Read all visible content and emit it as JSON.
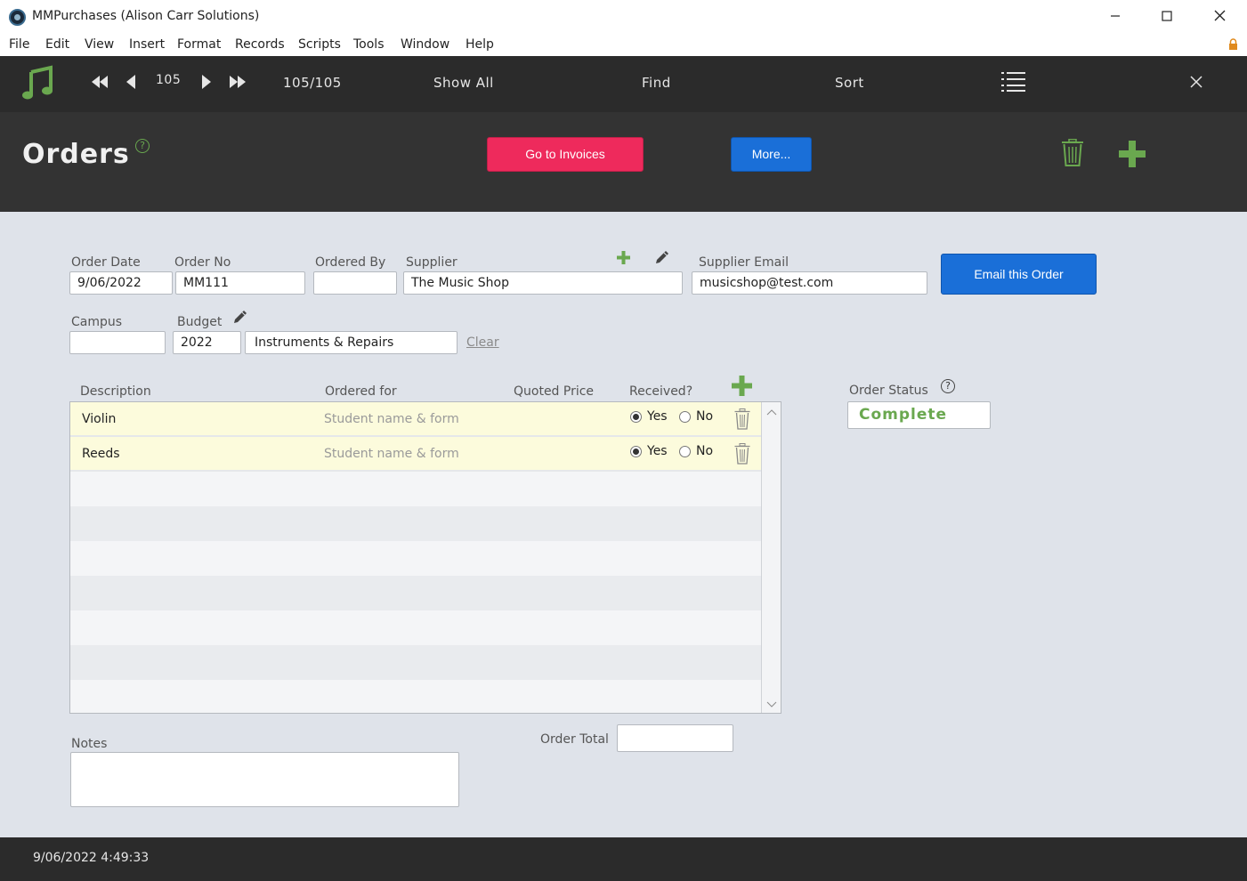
{
  "window": {
    "title": "MMPurchases (Alison Carr Solutions)",
    "minimize": "—",
    "maximize": "☐",
    "close": "✕"
  },
  "menu": [
    "File",
    "Edit",
    "View",
    "Insert",
    "Format",
    "Records",
    "Scripts",
    "Tools",
    "Window",
    "Help"
  ],
  "toolbar": {
    "record_number": "105",
    "record_count": "105/105",
    "show_all": "Show All",
    "find": "Find",
    "sort": "Sort"
  },
  "header": {
    "title": "Orders",
    "help": "?",
    "go_to_invoices": "Go to Invoices",
    "more": "More..."
  },
  "form": {
    "order_date": {
      "label": "Order Date",
      "value": "9/06/2022"
    },
    "order_no": {
      "label": "Order No",
      "value": "MM111"
    },
    "ordered_by": {
      "label": "Ordered By",
      "value": ""
    },
    "supplier": {
      "label": "Supplier",
      "value": "The Music Shop"
    },
    "supplier_email": {
      "label": "Supplier Email",
      "value": "musicshop@test.com"
    },
    "email_button": "Email this Order",
    "campus": {
      "label": "Campus",
      "value": ""
    },
    "budget": {
      "label": "Budget",
      "year": "2022",
      "name": "Instruments & Repairs"
    },
    "clear": "Clear"
  },
  "portal": {
    "headers": {
      "description": "Description",
      "ordered_for": "Ordered for",
      "quoted_price": "Quoted Price",
      "received": "Received?"
    },
    "rows": [
      {
        "description": "Violin",
        "ordered_for_placeholder": "Student name & form",
        "received": "Yes"
      },
      {
        "description": "Reeds",
        "ordered_for_placeholder": "Student name & form",
        "received": "Yes"
      }
    ],
    "yes_label": "Yes",
    "no_label": "No"
  },
  "status": {
    "label": "Order Status",
    "help": "?",
    "value": "Complete"
  },
  "notes": {
    "label": "Notes",
    "value": ""
  },
  "total": {
    "label": "Order Total",
    "value": ""
  },
  "footer": {
    "timestamp": "9/06/2022 4:49:33"
  },
  "colors": {
    "accent_green": "#6aa84f",
    "invoice_pink": "#ee2a5c",
    "button_blue": "#1a6fd8",
    "dark_bar": "#2b2b2b"
  }
}
